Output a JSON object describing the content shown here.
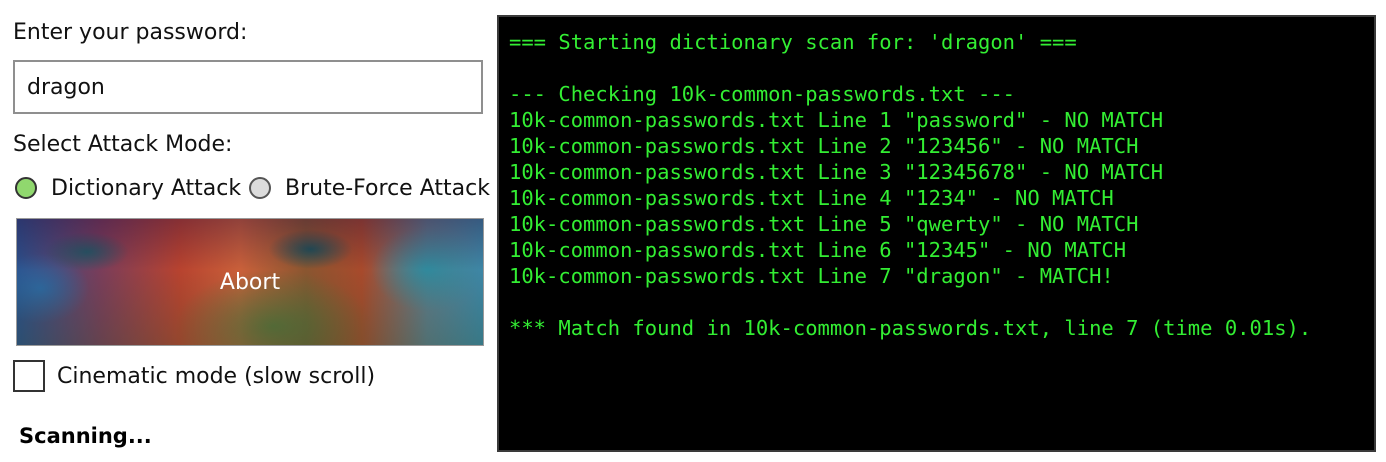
{
  "form": {
    "password_label": "Enter your password:",
    "password_value": "dragon",
    "attack_mode_label": "Select Attack Mode:",
    "modes": [
      {
        "label": "Dictionary Attack",
        "selected": true
      },
      {
        "label": "Brute-Force Attack",
        "selected": false
      }
    ],
    "abort_label": "Abort",
    "cinematic_label": "Cinematic mode (slow scroll)",
    "cinematic_checked": false,
    "status": "Scanning..."
  },
  "colors": {
    "terminal_bg": "#000000",
    "terminal_text": "#33ee33",
    "radio_selected": "#90d86e",
    "radio_unselected": "#dcdcdc"
  },
  "terminal": {
    "lines": [
      "=== Starting dictionary scan for: 'dragon' ===",
      "",
      "--- Checking 10k-common-passwords.txt ---",
      "10k-common-passwords.txt Line 1 \"password\" - NO MATCH",
      "10k-common-passwords.txt Line 2 \"123456\" - NO MATCH",
      "10k-common-passwords.txt Line 3 \"12345678\" - NO MATCH",
      "10k-common-passwords.txt Line 4 \"1234\" - NO MATCH",
      "10k-common-passwords.txt Line 5 \"qwerty\" - NO MATCH",
      "10k-common-passwords.txt Line 6 \"12345\" - NO MATCH",
      "10k-common-passwords.txt Line 7 \"dragon\" - MATCH!",
      "",
      "*** Match found in 10k-common-passwords.txt, line 7 (time 0.01s)."
    ]
  }
}
